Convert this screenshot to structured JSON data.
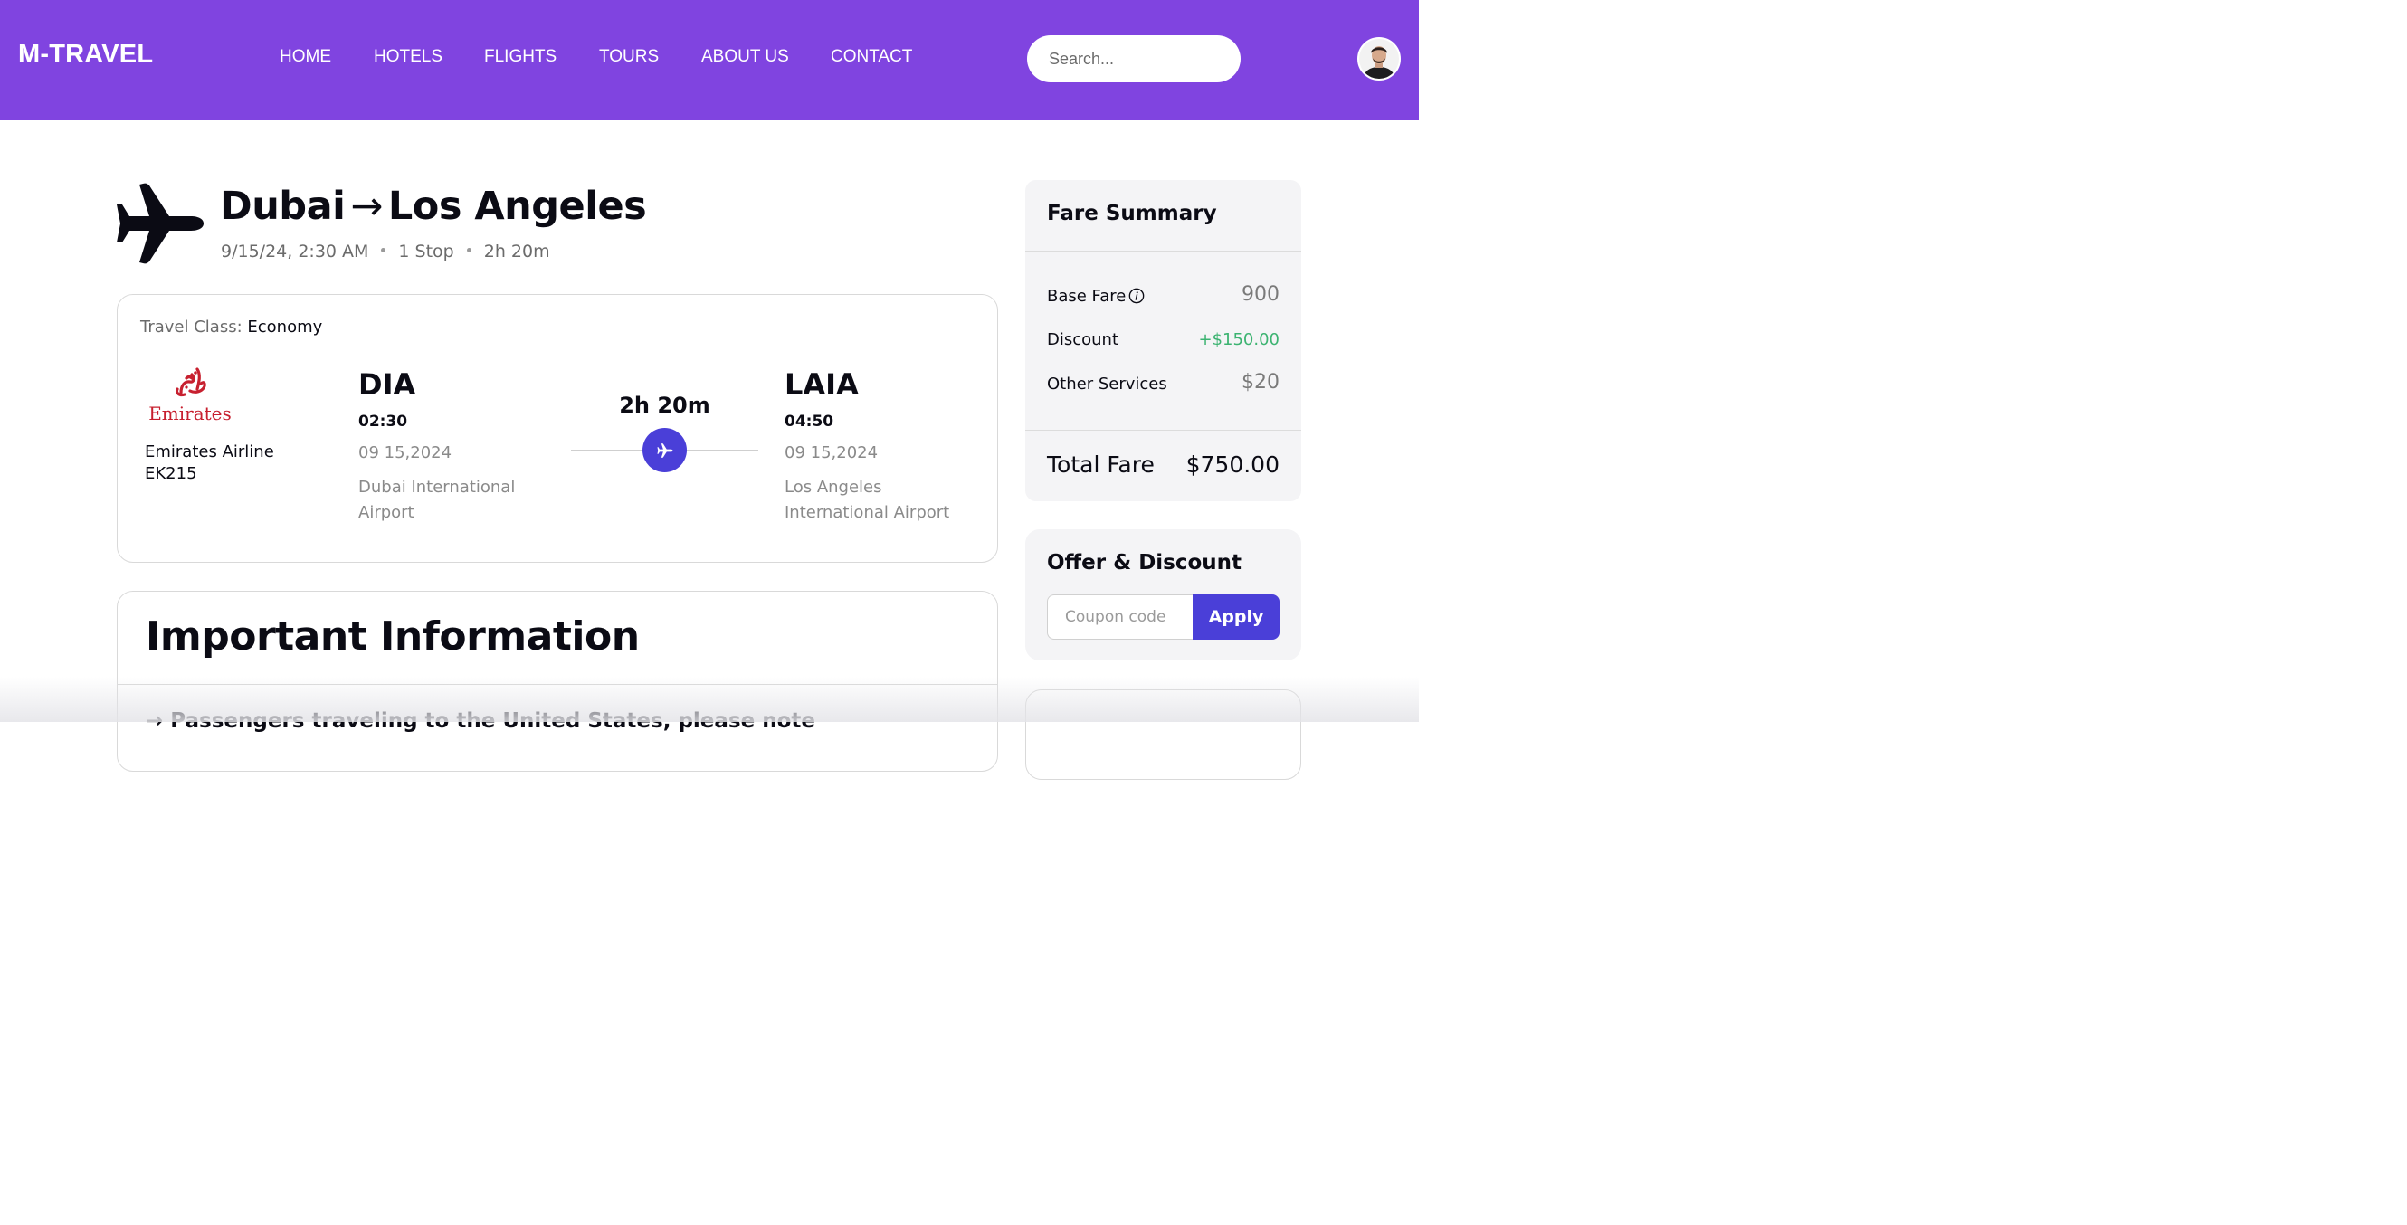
{
  "header": {
    "logo": "M-TRAVEL",
    "nav": [
      "HOME",
      "HOTELS",
      "FLIGHTS",
      "TOURS",
      "ABOUT US",
      "CONTACT"
    ],
    "search_placeholder": "Search..."
  },
  "route": {
    "from": "Dubai",
    "arrow": "→",
    "to": "Los Angeles",
    "datetime": "9/15/24, 2:30 AM",
    "stops": "1 Stop",
    "duration": "2h 20m"
  },
  "flight": {
    "class_label": "Travel Class:",
    "class_value": "Economy",
    "airline_logo_text": "Emirates",
    "airline_name": "Emirates Airline",
    "flight_code": "EK215",
    "departure": {
      "code": "DIA",
      "time": "02:30",
      "date": "09 15,2024",
      "airport": "Dubai International Airport"
    },
    "duration": "2h 20m",
    "arrival": {
      "code": "LAIA",
      "time": "04:50",
      "date": "09 15,2024",
      "airport": "Los Angeles International Airport"
    }
  },
  "info": {
    "title": "Important Information",
    "item": "→ Passengers traveling to the United States, please note"
  },
  "fare": {
    "title": "Fare Summary",
    "rows": [
      {
        "label": "Base Fare",
        "value": "900"
      },
      {
        "label": "Discount",
        "value": "+$150.00"
      },
      {
        "label": "Other Services",
        "value": "$20"
      }
    ],
    "total_label": "Total Fare",
    "total_value": "$750.00"
  },
  "offer": {
    "title": "Offer & Discount",
    "placeholder": "Coupon code",
    "apply": "Apply"
  },
  "colors": {
    "header": "#8044e0",
    "accent": "#4a3fd8",
    "discount": "#3cb371"
  }
}
